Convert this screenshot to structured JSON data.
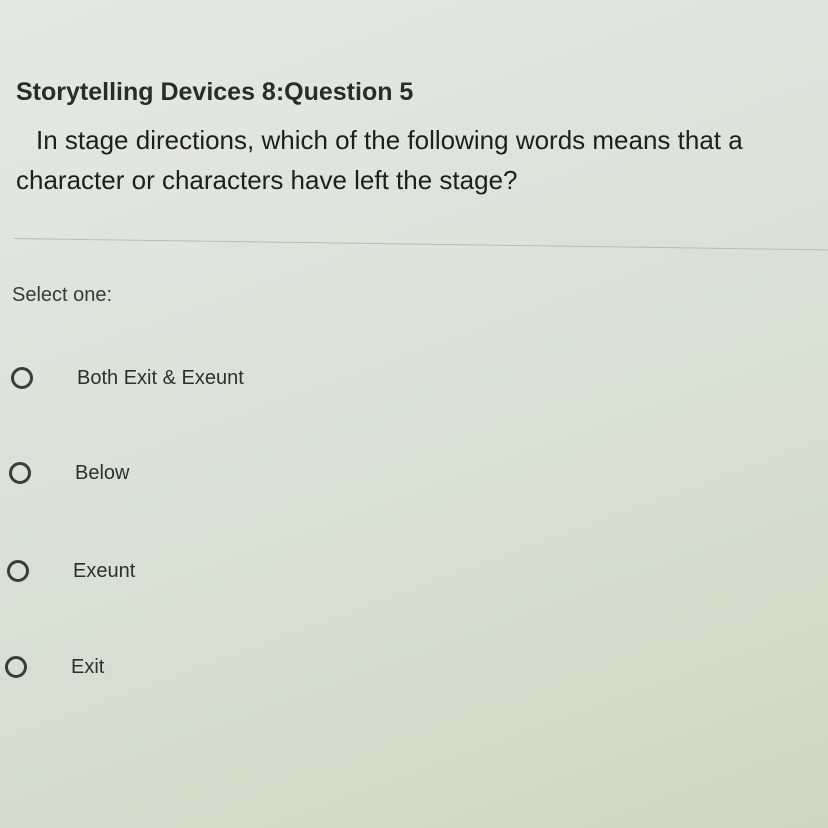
{
  "question": {
    "title": "Storytelling Devices 8:Question 5",
    "text": "In stage directions, which of the following words means that a character or characters have left the stage?",
    "prompt": "Select one:"
  },
  "options": [
    {
      "label": "Both Exit & Exeunt",
      "selected": false
    },
    {
      "label": "Below",
      "selected": false
    },
    {
      "label": "Exeunt",
      "selected": false
    },
    {
      "label": "Exit",
      "selected": false
    }
  ],
  "colors": {
    "text": "#262626",
    "radio_border": "#3c3c3c",
    "divider": "#b7bcb4"
  },
  "icons": {
    "radio": "radio-button-empty-icon"
  }
}
